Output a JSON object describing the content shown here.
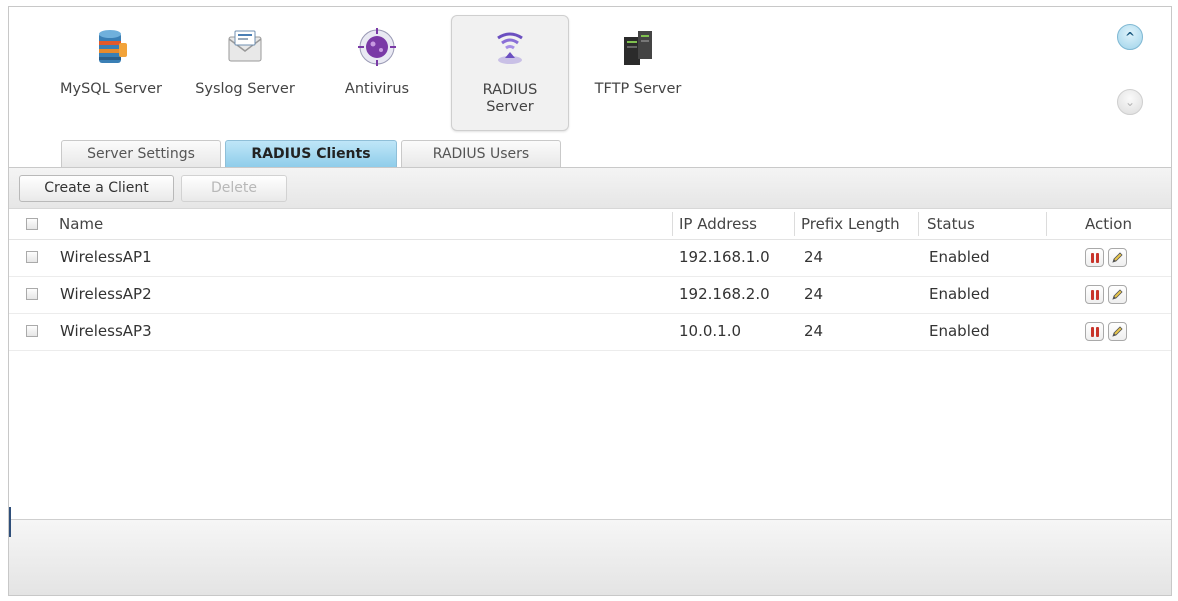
{
  "apps": [
    {
      "label": "MySQL Server",
      "icon": "database-icon"
    },
    {
      "label": "Syslog Server",
      "icon": "envelope-log-icon"
    },
    {
      "label": "Antivirus",
      "icon": "virus-shield-icon"
    },
    {
      "label_line1": "RADIUS",
      "label_line2": "Server",
      "icon": "radius-wifi-icon",
      "selected": true
    },
    {
      "label": "TFTP Server",
      "icon": "server-rack-icon"
    }
  ],
  "scroll": {
    "up_icon": "chevron-up-icon",
    "down_icon": "chevron-down-icon"
  },
  "tabs": [
    {
      "label": "Server Settings",
      "active": false
    },
    {
      "label": "RADIUS Clients",
      "active": true
    },
    {
      "label": "RADIUS Users",
      "active": false
    }
  ],
  "toolbar": {
    "create_label": "Create a Client",
    "delete_label": "Delete"
  },
  "table": {
    "headers": {
      "name": "Name",
      "ip": "IP Address",
      "prefix": "Prefix Length",
      "status": "Status",
      "action": "Action"
    },
    "rows": [
      {
        "name": "WirelessAP1",
        "ip": "192.168.1.0",
        "prefix": "24",
        "status": "Enabled"
      },
      {
        "name": "WirelessAP2",
        "ip": "192.168.2.0",
        "prefix": "24",
        "status": "Enabled"
      },
      {
        "name": "WirelessAP3",
        "ip": "10.0.1.0",
        "prefix": "24",
        "status": "Enabled"
      }
    ],
    "row_actions": [
      "stop-icon",
      "edit-icon"
    ]
  },
  "colors": {
    "active_tab": "#9fd3ee",
    "stop_red": "#c8342a"
  }
}
